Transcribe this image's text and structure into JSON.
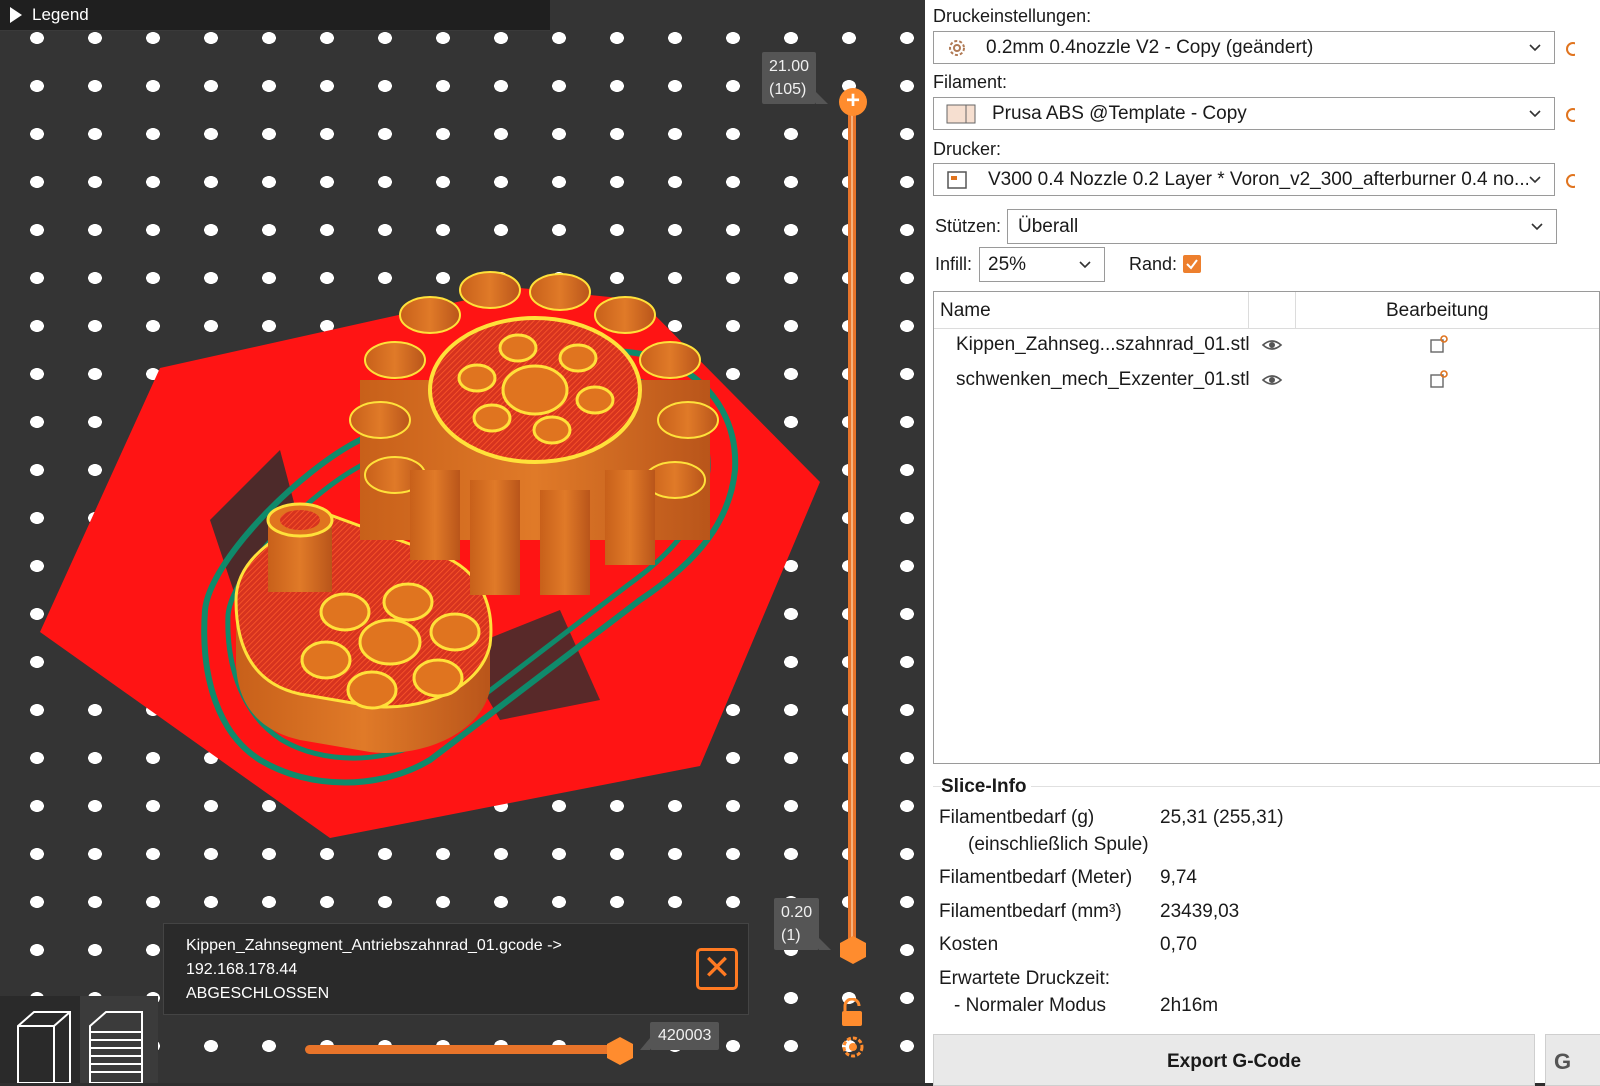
{
  "colors": {
    "accent": "#ed7f2d",
    "bed": "#343434",
    "skirt_red": "#ff1414",
    "perimeter_yellow": "#ffe13a",
    "model_orange": "#e0741f",
    "brim_green": "#0f8a6b"
  },
  "viewport": {
    "legend_label": "Legend",
    "layer_top": {
      "height": "21.00",
      "index": "(105)"
    },
    "layer_bottom": {
      "height": "0.20",
      "index": "(1)"
    },
    "hslider_value": "420003",
    "notification": {
      "line1": "Kippen_Zahnsegment_Antriebszahnrad_01.gcode ->",
      "line2": "192.168.178.44",
      "line3": "ABGESCHLOSSEN"
    },
    "icons": {
      "close": "close-icon",
      "lock": "unlock-icon",
      "settings": "gear-icon",
      "view3d": "cube-icon",
      "preview": "layers-icon"
    }
  },
  "panel": {
    "print_settings": {
      "label": "Druckeinstellungen:",
      "value": "0.2mm 0.4nozzle V2 - Copy (geändert)"
    },
    "filament": {
      "label": "Filament:",
      "value": "Prusa ABS @Template - Copy"
    },
    "printer": {
      "label": "Drucker:",
      "value": "V300 0.4 Nozzle 0.2 Layer * Voron_v2_300_afterburner 0.4 no..."
    },
    "supports": {
      "label": "Stützen:",
      "value": "Überall"
    },
    "infill": {
      "label": "Infill:",
      "value": "25%"
    },
    "brim": {
      "label": "Rand:",
      "checked": true
    },
    "object_list": {
      "col_name": "Name",
      "col_edit": "Bearbeitung",
      "rows": [
        {
          "name": "Kippen_Zahnseg...szahnrad_01.stl"
        },
        {
          "name": "schwenken_mech_Exzenter_01.stl"
        }
      ]
    },
    "slice_info": {
      "title": "Slice-Info",
      "filament_g_label": "Filamentbedarf (g)",
      "filament_g_sub": "(einschließlich Spule)",
      "filament_g_value": "25,31 (255,31)",
      "filament_m_label": "Filamentbedarf (Meter)",
      "filament_m_value": "9,74",
      "filament_mm3_label": "Filamentbedarf (mm³)",
      "filament_mm3_value": "23439,03",
      "cost_label": "Kosten",
      "cost_value": "0,70",
      "time_label": "Erwartete Druckzeit:",
      "normal_label": "- Normaler Modus",
      "normal_value": "2h16m"
    },
    "export_label": "Export G-Code",
    "g_label": "G"
  }
}
